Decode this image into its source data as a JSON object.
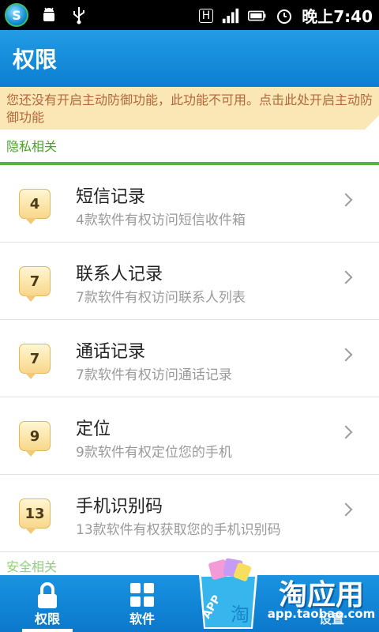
{
  "status_bar": {
    "network_label": "H",
    "time": "晚上7:40"
  },
  "header": {
    "title": "权限"
  },
  "banner": {
    "text": "您还没有开启主动防御功能，此功能不可用。点击此处开启主动防御功能"
  },
  "sections": {
    "privacy": "隐私相关",
    "security": "安全相关"
  },
  "permissions": [
    {
      "count": "4",
      "title": "短信记录",
      "subtitle": "4款软件有权访问短信收件箱"
    },
    {
      "count": "7",
      "title": "联系人记录",
      "subtitle": "7款软件有权访问联系人列表"
    },
    {
      "count": "7",
      "title": "通话记录",
      "subtitle": "7款软件有权访问通话记录"
    },
    {
      "count": "9",
      "title": "定位",
      "subtitle": "9款软件有权定位您的手机"
    },
    {
      "count": "13",
      "title": "手机识别码",
      "subtitle": "13款软件有权获取您的手机识别码"
    }
  ],
  "nav": {
    "items": [
      {
        "label": "权限",
        "icon": "lock-icon",
        "active": true
      },
      {
        "label": "软件",
        "icon": "grid-icon",
        "active": false
      },
      {
        "label": "",
        "icon": "",
        "active": false
      },
      {
        "label": "设置",
        "icon": "settings-icon",
        "active": false
      }
    ]
  },
  "watermark": {
    "name": "淘应用",
    "url": "app.taobao.com",
    "bag_label": "APP",
    "bag_char": "淘"
  },
  "colors": {
    "title_bar": "#1a8fdc",
    "banner_bg": "#fbe7b6",
    "banner_text": "#b3683a",
    "section_green": "#4aa32a",
    "badge_fill": "#f8d78a"
  }
}
